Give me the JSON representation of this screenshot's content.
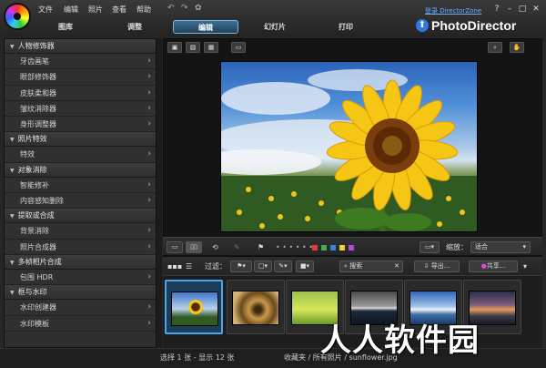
{
  "menu": {
    "file": "文件",
    "edit": "编辑",
    "photo": "照片",
    "view": "查看",
    "help": "帮助"
  },
  "account": {
    "login": "登录 DirectorZone"
  },
  "tabs": {
    "library": "图库",
    "adjust": "调整",
    "edit": "编辑",
    "slideshow": "幻灯片",
    "print": "打印"
  },
  "brand": {
    "name": "PhotoDirector"
  },
  "sidebar": {
    "sections": [
      {
        "title": "人物修饰器",
        "items": [
          "牙齿画笔",
          "眼部修饰器",
          "皮肤柔和器",
          "皱纹消除器",
          "身形调整器"
        ]
      },
      {
        "title": "照片特效",
        "items": [
          "特效"
        ]
      },
      {
        "title": "对象消除",
        "items": [
          "智能修补",
          "内容感知删除"
        ]
      },
      {
        "title": "提取或合成",
        "items": [
          "背景消除",
          "照片合成器"
        ]
      },
      {
        "title": "多帧相片合成",
        "items": [
          "包围 HDR"
        ]
      },
      {
        "title": "框与水印",
        "items": [
          "水印创建器",
          "水印模板"
        ]
      }
    ]
  },
  "toolbar": {
    "zoom_label": "缩放：",
    "zoom_value": "适合",
    "filter_label": "过滤：",
    "search_placeholder": "搜索",
    "export_label": "导出...",
    "share_label": "共享...",
    "color_labels": [
      "#e23b3b",
      "#3bb34a",
      "#3f7fe0",
      "#e5d23a",
      "#b64ae0"
    ]
  },
  "status": {
    "selection": "选择 1 张 - 显示 12 张",
    "path": "收藏夹 / 所有照片 / sunflower.jpg"
  },
  "watermark": "人人软件园"
}
